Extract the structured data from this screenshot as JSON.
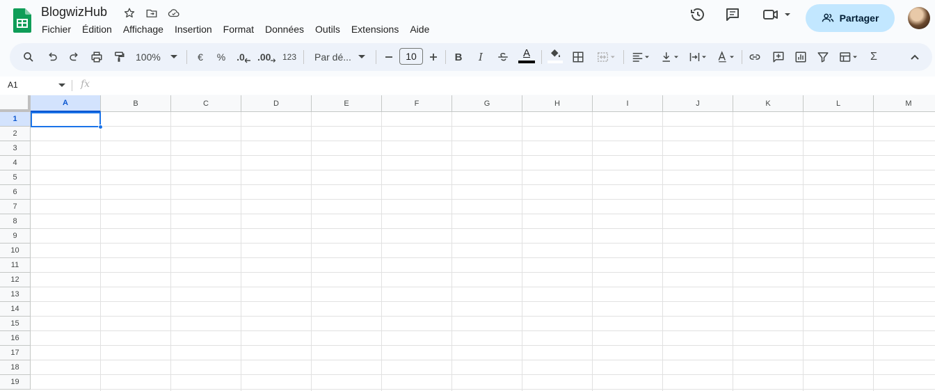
{
  "header": {
    "title": "BlogwizHub",
    "share_label": "Partager"
  },
  "menu": [
    "Fichier",
    "Édition",
    "Affichage",
    "Insertion",
    "Format",
    "Données",
    "Outils",
    "Extensions",
    "Aide"
  ],
  "toolbar": {
    "zoom": "100%",
    "currency": "€",
    "percent": "%",
    "decrease_decimals": ".0",
    "increase_decimals": ".00",
    "number_format": "123",
    "font_family": "Par dé...",
    "font_size": "10",
    "bold": "B",
    "italic": "I",
    "text_color": "A",
    "sum": "Σ"
  },
  "formula_bar": {
    "name_box": "A1",
    "fx": "fx"
  },
  "grid": {
    "columns": [
      "A",
      "B",
      "C",
      "D",
      "E",
      "F",
      "G",
      "H",
      "I",
      "J",
      "K",
      "L",
      "M"
    ],
    "rows": [
      "1",
      "2",
      "3",
      "4",
      "5",
      "6",
      "7",
      "8",
      "9",
      "10",
      "11",
      "12",
      "13",
      "14",
      "15",
      "16",
      "17",
      "18",
      "19"
    ],
    "selected_column": "A",
    "selected_row": "1"
  },
  "colors": {
    "brand_green": "#0f9d58",
    "selection_blue": "#1a73e8",
    "share_bg": "#c2e7ff"
  },
  "icons": {
    "logo": "sheets-logo",
    "star": "star-icon",
    "move": "move-to-folder-icon",
    "cloud": "cloud-saved-icon",
    "history": "history-icon",
    "comments": "comment-icon",
    "meet": "video-call-icon",
    "share": "people-icon"
  }
}
